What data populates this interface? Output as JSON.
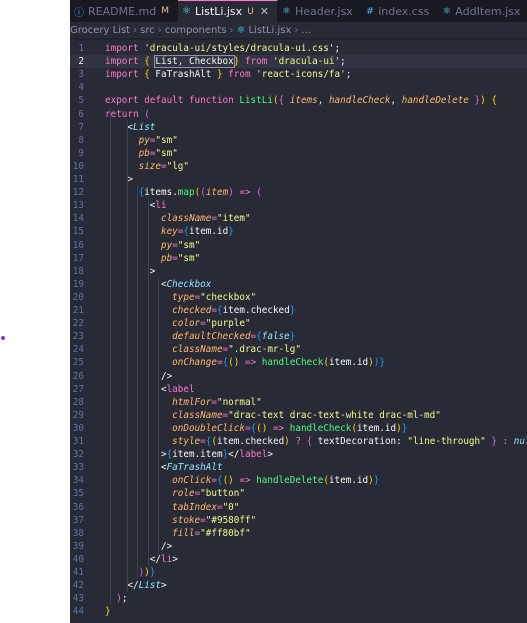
{
  "tabs": [
    {
      "icon": "info-icon",
      "icon_glyph": "ⓘ",
      "icon_color": "#4aa3ff",
      "label": "README.md",
      "badge": "M",
      "active": false
    },
    {
      "icon": "react-icon",
      "icon_glyph": "⚛",
      "icon_color": "#61dafb",
      "label": "ListLi.jsx",
      "badge": "U",
      "active": true
    },
    {
      "icon": "react-icon",
      "icon_glyph": "⚛",
      "icon_color": "#61dafb",
      "label": "Header.jsx",
      "badge": "",
      "active": false
    },
    {
      "icon": "hash-icon",
      "icon_glyph": "#",
      "icon_color": "#42a5f5",
      "label": "index.css",
      "badge": "",
      "active": false
    },
    {
      "icon": "react-icon",
      "icon_glyph": "⚛",
      "icon_color": "#61dafb",
      "label": "AddItem.jsx",
      "badge": "",
      "active": false
    }
  ],
  "breadcrumb": [
    "Grocery List",
    "src",
    "components",
    "ListLi.jsx",
    "..."
  ],
  "breadcrumb_icon": "react-icon",
  "current_line": 2,
  "code": [
    [
      [
        "k",
        "import "
      ],
      [
        "s",
        "'dracula-ui/styles/dracula-ui.css'"
      ],
      [
        "",
        "; "
      ]
    ],
    [
      [
        "k",
        "import "
      ],
      [
        "b1",
        "{ "
      ],
      [
        "hl",
        "List, Checkbox"
      ],
      [
        "b1",
        "}"
      ],
      [
        "k",
        " from "
      ],
      [
        "s",
        "'dracula-ui'"
      ],
      [
        "",
        ";"
      ]
    ],
    [
      [
        "k",
        "import "
      ],
      [
        "b1",
        "{ "
      ],
      [
        "",
        "FaTrashAlt "
      ],
      [
        "b1",
        "}"
      ],
      [
        "k",
        " from "
      ],
      [
        "s",
        "'react-icons/fa'"
      ],
      [
        "",
        ";"
      ]
    ],
    [],
    [
      [
        "k",
        "export default function "
      ],
      [
        "f",
        "ListLi"
      ],
      [
        "b1",
        "("
      ],
      [
        "b2",
        "{ "
      ],
      [
        "p",
        "items"
      ],
      [
        "",
        ", "
      ],
      [
        "p",
        "handleCheck"
      ],
      [
        "",
        ", "
      ],
      [
        "p",
        "handleDelete"
      ],
      [
        "b2",
        " }"
      ],
      [
        "b1",
        ")"
      ],
      [
        "",
        " "
      ],
      [
        "b1",
        "{"
      ]
    ],
    [
      [
        "",
        ""
      ],
      [
        "k",
        "return "
      ],
      [
        "b2",
        "("
      ]
    ],
    [
      [
        "",
        "    <"
      ],
      [
        "c",
        "List"
      ]
    ],
    [
      [
        "",
        "      "
      ],
      [
        "p",
        "py"
      ],
      [
        "k",
        "="
      ],
      [
        "s",
        "\"sm\""
      ]
    ],
    [
      [
        "",
        "      "
      ],
      [
        "p",
        "pb"
      ],
      [
        "k",
        "="
      ],
      [
        "s",
        "\"sm\""
      ]
    ],
    [
      [
        "",
        "      "
      ],
      [
        "p",
        "size"
      ],
      [
        "k",
        "="
      ],
      [
        "s",
        "\"lg\""
      ]
    ],
    [
      [
        "",
        "    >"
      ]
    ],
    [
      [
        "",
        "      "
      ],
      [
        "b3",
        "{"
      ],
      [
        "",
        "items."
      ],
      [
        "f",
        "map"
      ],
      [
        "b1",
        "("
      ],
      [
        "b2",
        "("
      ],
      [
        "p",
        "item"
      ],
      [
        "b2",
        ")"
      ],
      [
        "k",
        " => "
      ],
      [
        "b2",
        "("
      ]
    ],
    [
      [
        "",
        "        <"
      ],
      [
        "k",
        "li"
      ]
    ],
    [
      [
        "",
        "          "
      ],
      [
        "p",
        "className"
      ],
      [
        "k",
        "="
      ],
      [
        "s",
        "\"item\""
      ]
    ],
    [
      [
        "",
        "          "
      ],
      [
        "p",
        "key"
      ],
      [
        "k",
        "="
      ],
      [
        "b3",
        "{"
      ],
      [
        "",
        "item.id"
      ],
      [
        "b3",
        "}"
      ]
    ],
    [
      [
        "",
        "          "
      ],
      [
        "p",
        "py"
      ],
      [
        "k",
        "="
      ],
      [
        "s",
        "\"sm\""
      ]
    ],
    [
      [
        "",
        "          "
      ],
      [
        "p",
        "pb"
      ],
      [
        "k",
        "="
      ],
      [
        "s",
        "\"sm\""
      ]
    ],
    [
      [
        "",
        "        >"
      ]
    ],
    [
      [
        "",
        "          <"
      ],
      [
        "c",
        "Checkbox"
      ]
    ],
    [
      [
        "",
        "            "
      ],
      [
        "p",
        "type"
      ],
      [
        "k",
        "="
      ],
      [
        "s",
        "\"checkbox\""
      ]
    ],
    [
      [
        "",
        "            "
      ],
      [
        "p",
        "checked"
      ],
      [
        "k",
        "="
      ],
      [
        "b3",
        "{"
      ],
      [
        "",
        "item.checked"
      ],
      [
        "b3",
        "}"
      ]
    ],
    [
      [
        "",
        "            "
      ],
      [
        "p",
        "color"
      ],
      [
        "k",
        "="
      ],
      [
        "s",
        "\"purple\""
      ]
    ],
    [
      [
        "",
        "            "
      ],
      [
        "p",
        "defaultChecked"
      ],
      [
        "k",
        "="
      ],
      [
        "b3",
        "{"
      ],
      [
        "c",
        "false"
      ],
      [
        "b3",
        "}"
      ]
    ],
    [
      [
        "",
        "            "
      ],
      [
        "p",
        "className"
      ],
      [
        "k",
        "="
      ],
      [
        "s",
        "\".drac-mr-lg\""
      ]
    ],
    [
      [
        "",
        "            "
      ],
      [
        "p",
        "onChange"
      ],
      [
        "k",
        "="
      ],
      [
        "b3",
        "{"
      ],
      [
        "b1",
        "()"
      ],
      [
        "k",
        " => "
      ],
      [
        "f",
        "handleCheck"
      ],
      [
        "b1",
        "("
      ],
      [
        "",
        "item.id"
      ],
      [
        "b1",
        ")"
      ],
      [
        "b3",
        ")"
      ],
      [
        "b3",
        "}"
      ]
    ],
    [
      [
        "",
        "          />"
      ]
    ],
    [
      [
        "",
        "          <"
      ],
      [
        "k",
        "label"
      ]
    ],
    [
      [
        "",
        "            "
      ],
      [
        "p",
        "htmlFor"
      ],
      [
        "k",
        "="
      ],
      [
        "s",
        "\"normal\""
      ]
    ],
    [
      [
        "",
        "            "
      ],
      [
        "p",
        "className"
      ],
      [
        "k",
        "="
      ],
      [
        "s",
        "\"drac-text drac-text-white drac-ml-md\""
      ]
    ],
    [
      [
        "",
        "            "
      ],
      [
        "p",
        "onDoubleClick"
      ],
      [
        "k",
        "="
      ],
      [
        "b3",
        "{"
      ],
      [
        "b1",
        "()"
      ],
      [
        "k",
        " => "
      ],
      [
        "f",
        "handleCheck"
      ],
      [
        "b1",
        "("
      ],
      [
        "",
        "item.id"
      ],
      [
        "b1",
        ")"
      ],
      [
        "b3",
        "}"
      ]
    ],
    [
      [
        "",
        "            "
      ],
      [
        "p",
        "style"
      ],
      [
        "k",
        "="
      ],
      [
        "b3",
        "{"
      ],
      [
        "b1",
        "("
      ],
      [
        "",
        "item.checked"
      ],
      [
        "b1",
        ")"
      ],
      [
        "k",
        " ? "
      ],
      [
        "b2",
        "{ "
      ],
      [
        "",
        "textDecoration: "
      ],
      [
        "s",
        "\"line-through\""
      ],
      [
        "b2",
        " }"
      ],
      [
        "k",
        " : "
      ],
      [
        "c",
        "null"
      ],
      [
        "b3",
        "}"
      ]
    ],
    [
      [
        "",
        "          >"
      ],
      [
        "b3",
        "{"
      ],
      [
        "",
        "item.item"
      ],
      [
        "b3",
        "}"
      ],
      [
        "",
        "</"
      ],
      [
        "k",
        "label"
      ],
      [
        "",
        ">"
      ]
    ],
    [
      [
        "",
        "          <"
      ],
      [
        "c",
        "FaTrashAlt"
      ]
    ],
    [
      [
        "",
        "            "
      ],
      [
        "p",
        "onClick"
      ],
      [
        "k",
        "="
      ],
      [
        "b3",
        "{"
      ],
      [
        "b1",
        "()"
      ],
      [
        "k",
        " => "
      ],
      [
        "f",
        "handleDelete"
      ],
      [
        "b1",
        "("
      ],
      [
        "",
        "item.id"
      ],
      [
        "b1",
        ")"
      ],
      [
        "b3",
        "}"
      ]
    ],
    [
      [
        "",
        "            "
      ],
      [
        "p",
        "role"
      ],
      [
        "k",
        "="
      ],
      [
        "s",
        "\"button\""
      ]
    ],
    [
      [
        "",
        "            "
      ],
      [
        "p",
        "tabIndex"
      ],
      [
        "k",
        "="
      ],
      [
        "s",
        "\"0\""
      ]
    ],
    [
      [
        "",
        "            "
      ],
      [
        "p",
        "stoke"
      ],
      [
        "k",
        "="
      ],
      [
        "s",
        "\"#9580ff\""
      ]
    ],
    [
      [
        "",
        "            "
      ],
      [
        "p",
        "fill"
      ],
      [
        "k",
        "="
      ],
      [
        "s",
        "\"#ff80bf\""
      ]
    ],
    [
      [
        "",
        "          />"
      ]
    ],
    [
      [
        "",
        "        </"
      ],
      [
        "k",
        "li"
      ],
      [
        "",
        ">"
      ]
    ],
    [
      [
        "",
        "      "
      ],
      [
        "b2",
        ")"
      ],
      [
        "b1",
        ")"
      ],
      [
        "b3",
        "}"
      ]
    ],
    [
      [
        "",
        "    </"
      ],
      [
        "c",
        "List"
      ],
      [
        "",
        ">"
      ]
    ],
    [
      [
        "",
        "  "
      ],
      [
        "b2",
        ")"
      ],
      [
        "",
        ";"
      ]
    ],
    [
      [
        "b1",
        "}"
      ]
    ]
  ],
  "colors": {
    "background": "#282a36",
    "pink": "#ff79c6",
    "yellow": "#f1fa8c",
    "green": "#50fa7b",
    "orange": "#ffb86c",
    "cyan": "#8be9fd",
    "comment": "#6272a4"
  }
}
